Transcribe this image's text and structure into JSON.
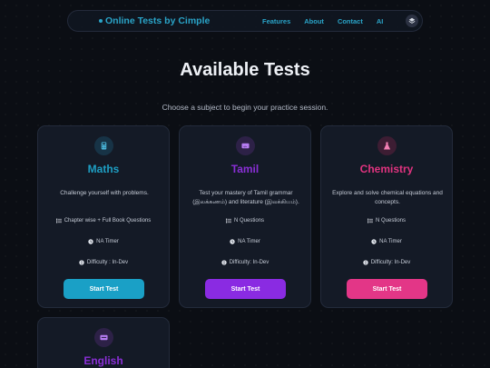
{
  "nav": {
    "brand": "Online Tests by Cimple",
    "links": [
      "Features",
      "About",
      "Contact",
      "AI"
    ],
    "theme_icon": "layers-icon"
  },
  "hero": {
    "title": "Available Tests",
    "subtitle": "Choose a subject to begin your practice session."
  },
  "cards": [
    {
      "title": "Maths",
      "icon": "calculator-icon",
      "description": "Challenge yourself with problems.",
      "features": [
        "Chapter wise + Full Book Questions",
        "NA Timer",
        "Difficulty : In-Dev"
      ],
      "button": "Start Test",
      "accent": "#1aa0c6"
    },
    {
      "title": "Tamil",
      "icon": "language-icon",
      "description": "Test your mastery of Tamil grammar (இலக்கணம்) and literature (இலக்கியம்).",
      "features": [
        "N Questions",
        "NA Timer",
        "Difficulty: In-Dev"
      ],
      "button": "Start Test",
      "accent": "#8a2be2"
    },
    {
      "title": "Chemistry",
      "icon": "flask-icon",
      "description": "Explore and solve chemical equations and concepts.",
      "features": [
        "N Questions",
        "NA Timer",
        "Difficulty: In-Dev"
      ],
      "button": "Start Test",
      "accent": "#e33687"
    },
    {
      "title": "English",
      "icon": "language-icon",
      "accent": "#8a2be2"
    }
  ]
}
